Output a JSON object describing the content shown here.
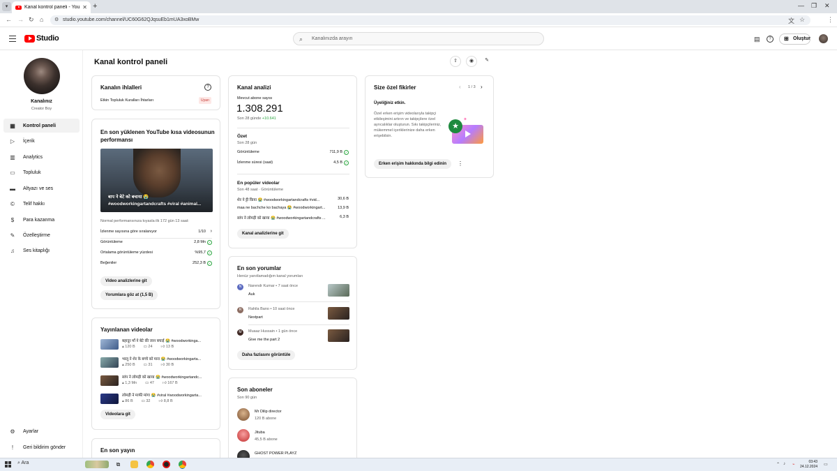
{
  "browser": {
    "tab_title": "Kanal kontrol paneli - YouTube",
    "url": "studio.youtube.com/channel/UC60G62QJqsuEb1mUA3xoBMw"
  },
  "header": {
    "logo_text": "Studio",
    "search_placeholder": "Kanalınızda arayın",
    "create_label": "Oluştur"
  },
  "sidebar": {
    "channel_name": "Kanalınız",
    "channel_subtitle": "Creator Boy",
    "items": [
      {
        "label": "Kontrol paneli",
        "icon": "dashboard-icon"
      },
      {
        "label": "İçerik",
        "icon": "content-icon"
      },
      {
        "label": "Analytics",
        "icon": "analytics-icon"
      },
      {
        "label": "Topluluk",
        "icon": "community-icon"
      },
      {
        "label": "Altyazı ve ses",
        "icon": "subtitles-icon"
      },
      {
        "label": "Telif hakkı",
        "icon": "copyright-icon"
      },
      {
        "label": "Para kazanma",
        "icon": "monetization-icon"
      },
      {
        "label": "Özelleştirme",
        "icon": "customization-icon"
      },
      {
        "label": "Ses kitaplığı",
        "icon": "audio-library-icon"
      }
    ],
    "bottom": [
      {
        "label": "Ayarlar",
        "icon": "settings-icon"
      },
      {
        "label": "Geri bildirim gönder",
        "icon": "feedback-icon"
      }
    ]
  },
  "page_title": "Kanal kontrol paneli",
  "violations": {
    "title": "Kanalın ihlalleri",
    "row_label": "Etkin Topluluk Kuralları İhtarları",
    "badge": "Uyarı"
  },
  "latest_short": {
    "title": "En son yüklenen YouTube kısa videosunun performansı",
    "thumb_title": "बाप ने बेटे को बचाया 😭",
    "thumb_tags": "#woodworkingartandcrafts #viral #animal...",
    "note": "Normal performansınıza kıyasla ilk 172 gün 13 saat:",
    "rows": [
      {
        "label": "İzlenme sayısına göre sıralanıyor",
        "value": "1/10"
      },
      {
        "label": "Görüntüleme",
        "value": "2,8 Mn"
      },
      {
        "label": "Ortalama görüntüleme yüzdesi",
        "value": "%95,7"
      },
      {
        "label": "Beğeniler",
        "value": "252,3 B"
      }
    ],
    "btn_analytics": "Video analizlerine git",
    "btn_comments": "Yorumlara göz at (1,5 B)"
  },
  "published": {
    "title": "Yayınlanan videolar",
    "videos": [
      {
        "title": "बहादुर माँ ने बेटे की जान बचाई 😭 #woodworkinga...",
        "views": "120 B",
        "comments": "24",
        "likes": "13 B"
      },
      {
        "title": "भालू ने शेर के बच्चे को मारा 😭 #woodworkingarta...",
        "views": "250 B",
        "comments": "31",
        "likes": "30 B"
      },
      {
        "title": "सांप ने लोमड़ी को खाया 😭 #woodworkingartandc...",
        "views": "1,3 Mn",
        "comments": "47",
        "likes": "167 B"
      },
      {
        "title": "लोमड़ी ने माफी मांगा 😭 #viral #woodworkingarta...",
        "views": "86 B",
        "comments": "32",
        "likes": "8,8 B"
      }
    ],
    "btn": "Videolara git"
  },
  "latest_live": {
    "title": "En son yayın"
  },
  "analytics": {
    "title": "Kanal analizi",
    "subs_label": "Mevcut abone sayısı",
    "subs_value": "1.308.291",
    "subs_delta_prefix": "Son 28 günde",
    "subs_delta": "+10.641",
    "summary_title": "Özet",
    "summary_sub": "Son 28 gün",
    "summary_rows": [
      {
        "label": "Görüntüleme",
        "value": "711,9 B"
      },
      {
        "label": "İzlenme süresi (saat)",
        "value": "4,5 B"
      }
    ],
    "popular_title": "En popüler videolar",
    "popular_sub": "Son 48 saat · Görüntüleme",
    "popular": [
      {
        "title": "शेर ने ट्टी किया 😭 #woodworkingartandcrafts #vid...",
        "value": "30,6 B"
      },
      {
        "title": "maa ne bachche ko bachaya 😭 #woodworkingart...",
        "value": "13,9 B"
      },
      {
        "title": "सांप ने लोमड़ी को खाया 😭 #woodworkingartandcrafts ...",
        "value": "6,3 B"
      }
    ],
    "btn": "Kanal analizlerine git"
  },
  "comments": {
    "title": "En son yorumlar",
    "sub": "Henüz yanıtlamadığım kanal yorumları",
    "items": [
      {
        "author": "Narendr Kumar",
        "time": "7 saat önce",
        "text": "Auk",
        "avatar_letter": "N",
        "color": "#5c6bc0"
      },
      {
        "author": "Rahila Bano",
        "time": "10 saat önce",
        "text": "Nextpart",
        "avatar_letter": "R",
        "color": "#8d6e63"
      },
      {
        "author": "Muaaz Hussain",
        "time": "1 gün önce",
        "text": "Give me the part 2",
        "avatar_letter": "M",
        "color": "#3e2723"
      }
    ],
    "btn": "Daha fazlasını görüntüle"
  },
  "subscribers": {
    "title": "Son aboneler",
    "sub": "Son 90 gün",
    "items": [
      {
        "name": "Mr Dilip director",
        "count": "120 B abone"
      },
      {
        "name": "Jituba",
        "count": "45,5 B abone"
      },
      {
        "name": "GHOST POWER PLAYZ",
        "count": ""
      }
    ]
  },
  "ideas": {
    "title": "Size özel fikirler",
    "pager": "1 / 3",
    "heading": "Üyeliğiniz etkin.",
    "body": "Özel erken erişim videolarıyla takipçi etkileşimini artırın ve takipçilere özel ayrıcalıklar oluşturun. Sıkı takipçileriniz, mükemmel içeriklerinize daha erken erişebilsin.",
    "btn": "Erken erişim hakkında bilgi edinin"
  },
  "taskbar": {
    "search_label": "Ara",
    "time": "03:43",
    "date": "24.12.2024"
  },
  "colors": {
    "accent_red": "#ff0000",
    "success_green": "#2ba640",
    "badge_bg": "#fde8e6",
    "badge_fg": "#c4302b"
  }
}
